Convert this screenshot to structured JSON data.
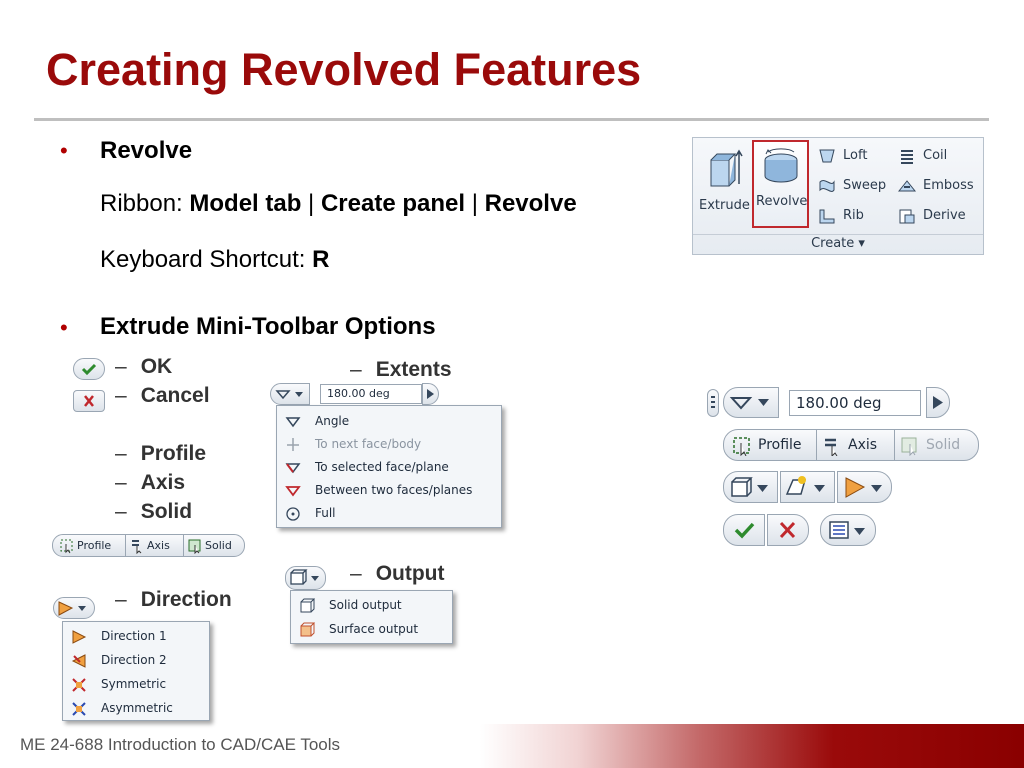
{
  "slide": {
    "title": "Creating Revolved Features",
    "footer": "ME 24-688 Introduction to CAD/CAE Tools"
  },
  "bullets": {
    "bullet_char": "•",
    "revolve": {
      "heading": "Revolve",
      "ribbon_prefix": "Ribbon: ",
      "ribbon_model": "Model tab",
      "sep1": " | ",
      "ribbon_create": "Create panel",
      "sep2": " | ",
      "ribbon_revolve": "Revolve",
      "shortcut_prefix": "Keyboard Shortcut: ",
      "shortcut_key": "R"
    },
    "toolbar": {
      "heading": "Extrude Mini-Toolbar Options",
      "dash": "–",
      "ok": "OK",
      "cancel": "Cancel",
      "profile": "Profile",
      "axis": "Axis",
      "solid": "Solid",
      "direction": "Direction",
      "extents": "Extents",
      "output": "Output"
    }
  },
  "ribbon": {
    "extrude": "Extrude",
    "revolve": "Revolve",
    "loft": "Loft",
    "sweep": "Sweep",
    "rib": "Rib",
    "coil": "Coil",
    "emboss": "Emboss",
    "derive": "Derive",
    "panel": "Create ▾",
    "highlight_color": "#c0282d"
  },
  "selector": {
    "profile": "Profile",
    "axis": "Axis",
    "solid": "Solid"
  },
  "extents": {
    "value": "180.00 deg",
    "items": [
      "Angle",
      "To next face/body",
      "To selected face/plane",
      "Between two faces/planes",
      "Full"
    ]
  },
  "output": {
    "items": [
      "Solid output",
      "Surface output"
    ]
  },
  "direction": {
    "items": [
      "Direction 1",
      "Direction 2",
      "Symmetric",
      "Asymmetric"
    ]
  },
  "minitoolbar": {
    "value": "180.00 deg",
    "profile": "Profile",
    "axis": "Axis",
    "solid": "Solid"
  }
}
